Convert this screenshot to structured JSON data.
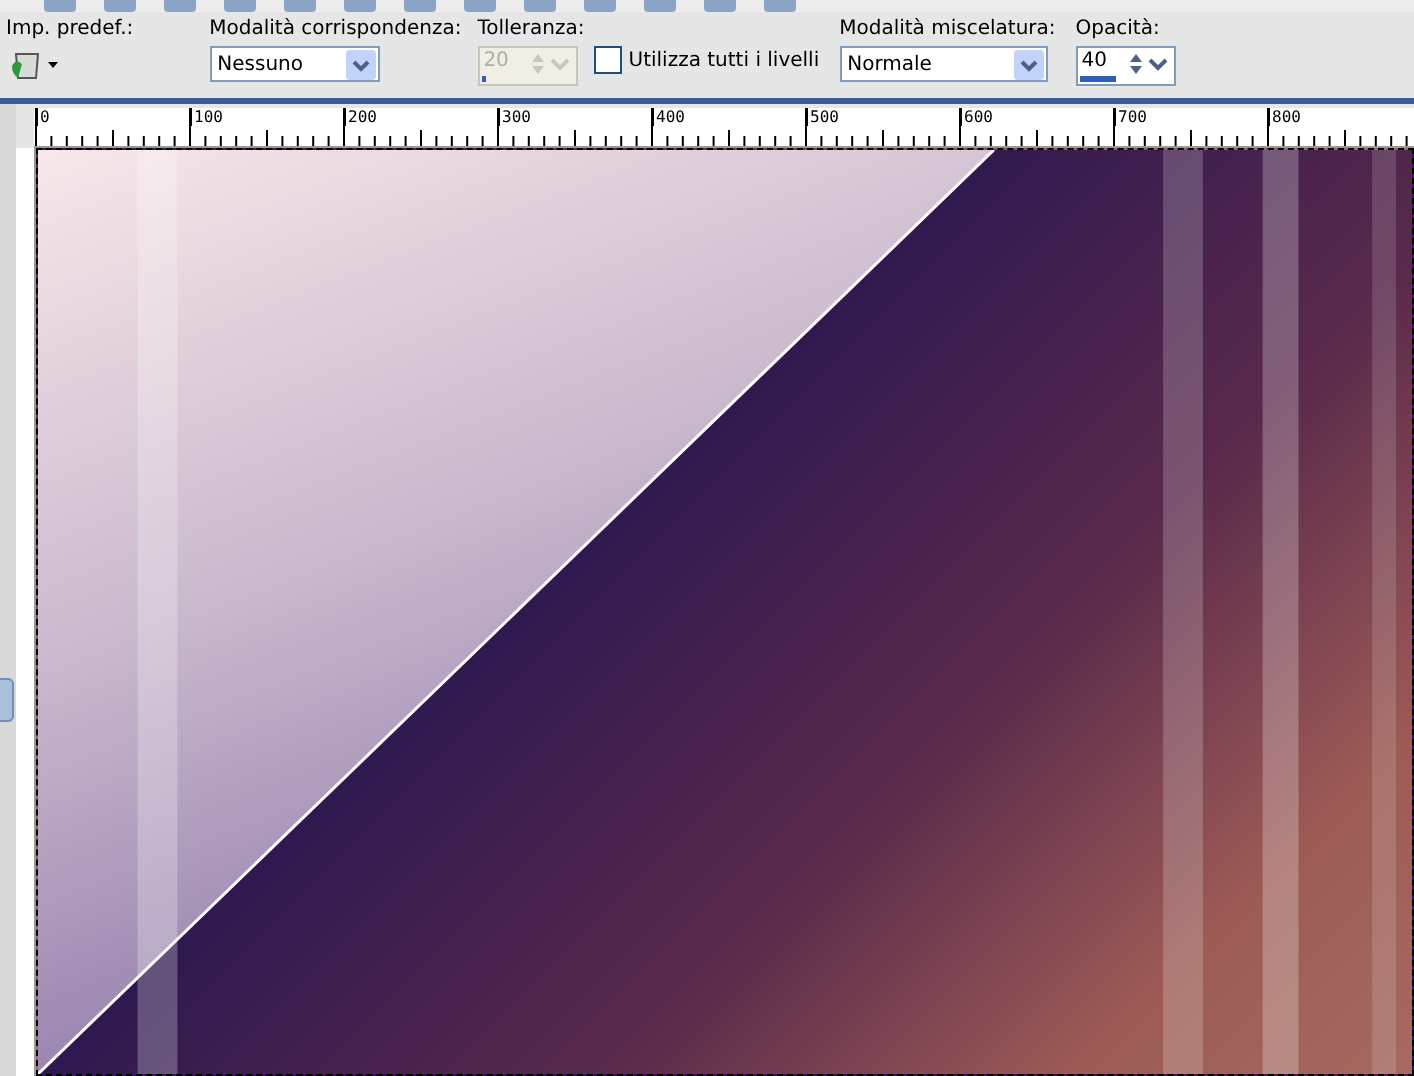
{
  "presets": {
    "label": "Imp. predef.:"
  },
  "match_mode": {
    "label": "Modalità corrispondenza:",
    "value": "Nessuno"
  },
  "tolerance": {
    "label": "Tolleranza:",
    "value": "20",
    "disabled": true,
    "level": 0.06
  },
  "use_all_layers": {
    "label": "Utilizza tutti i livelli",
    "checked": false
  },
  "blend_mode": {
    "label": "Modalità miscelatura:",
    "value": "Normale"
  },
  "opacity": {
    "label": "Opacità:",
    "value": "40",
    "level": 0.4
  },
  "ruler": {
    "labels": [
      "0",
      "100",
      "200",
      "300",
      "400",
      "500",
      "600",
      "700",
      "800"
    ]
  }
}
